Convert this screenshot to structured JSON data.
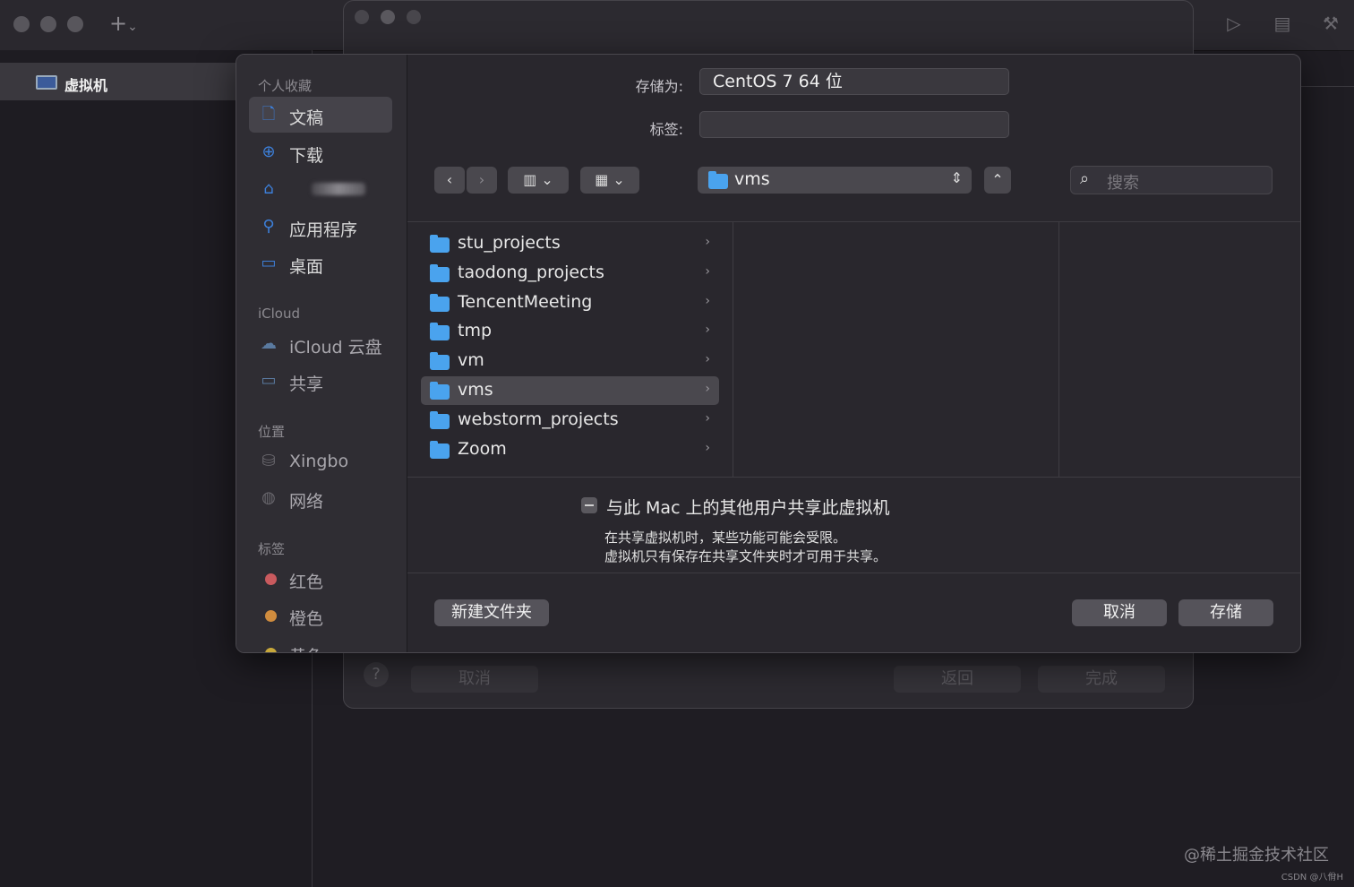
{
  "app": {
    "sidebar_item": "虚拟机"
  },
  "setup_window": {
    "cancel_label": "取消",
    "back_label": "返回",
    "done_label": "完成",
    "help_label": "?"
  },
  "dialog": {
    "save_as_label": "存储为:",
    "save_as_value": "CentOS 7 64 位",
    "tags_label": "标签:",
    "tags_value": "",
    "current_folder": "vms",
    "search_placeholder": "搜索",
    "sidebar": {
      "favorites_header": "个人收藏",
      "favorites": [
        {
          "label": "文稿",
          "icon": "document-icon"
        },
        {
          "label": "下载",
          "icon": "download-icon"
        },
        {
          "label": "",
          "icon": "home-icon"
        },
        {
          "label": "应用程序",
          "icon": "applications-icon"
        },
        {
          "label": "桌面",
          "icon": "desktop-icon"
        }
      ],
      "icloud_header": "iCloud",
      "icloud": [
        {
          "label": "iCloud 云盘",
          "icon": "cloud-icon"
        },
        {
          "label": "共享",
          "icon": "shared-folder-icon"
        }
      ],
      "locations_header": "位置",
      "locations": [
        {
          "label": "Xingbo",
          "icon": "disk-icon"
        },
        {
          "label": "网络",
          "icon": "globe-icon"
        }
      ],
      "tags_header": "标签",
      "tags": [
        {
          "label": "红色",
          "color": "#e0575a"
        },
        {
          "label": "橙色",
          "color": "#e6943a"
        },
        {
          "label": "黄色",
          "color": "#e8c43a"
        }
      ]
    },
    "folders": [
      {
        "name": "stu_projects"
      },
      {
        "name": "taodong_projects"
      },
      {
        "name": "TencentMeeting"
      },
      {
        "name": "tmp"
      },
      {
        "name": "vm"
      },
      {
        "name": "vms",
        "selected": true
      },
      {
        "name": "webstorm_projects"
      },
      {
        "name": "Zoom"
      }
    ],
    "share": {
      "checkbox_label": "与此 Mac 上的其他用户共享此虚拟机",
      "note_line1": "在共享虚拟机时，某些功能可能会受限。",
      "note_line2": "虚拟机只有保存在共享文件夹时才可用于共享。"
    },
    "new_folder_label": "新建文件夹",
    "cancel_label": "取消",
    "save_label": "存储"
  },
  "watermark": {
    "line1": "@稀土掘金技术社区",
    "line2": "CSDN @八佾H"
  },
  "colors": {
    "accent": "#4aa3ee",
    "sidebar_icon": "#3d7fd9"
  }
}
